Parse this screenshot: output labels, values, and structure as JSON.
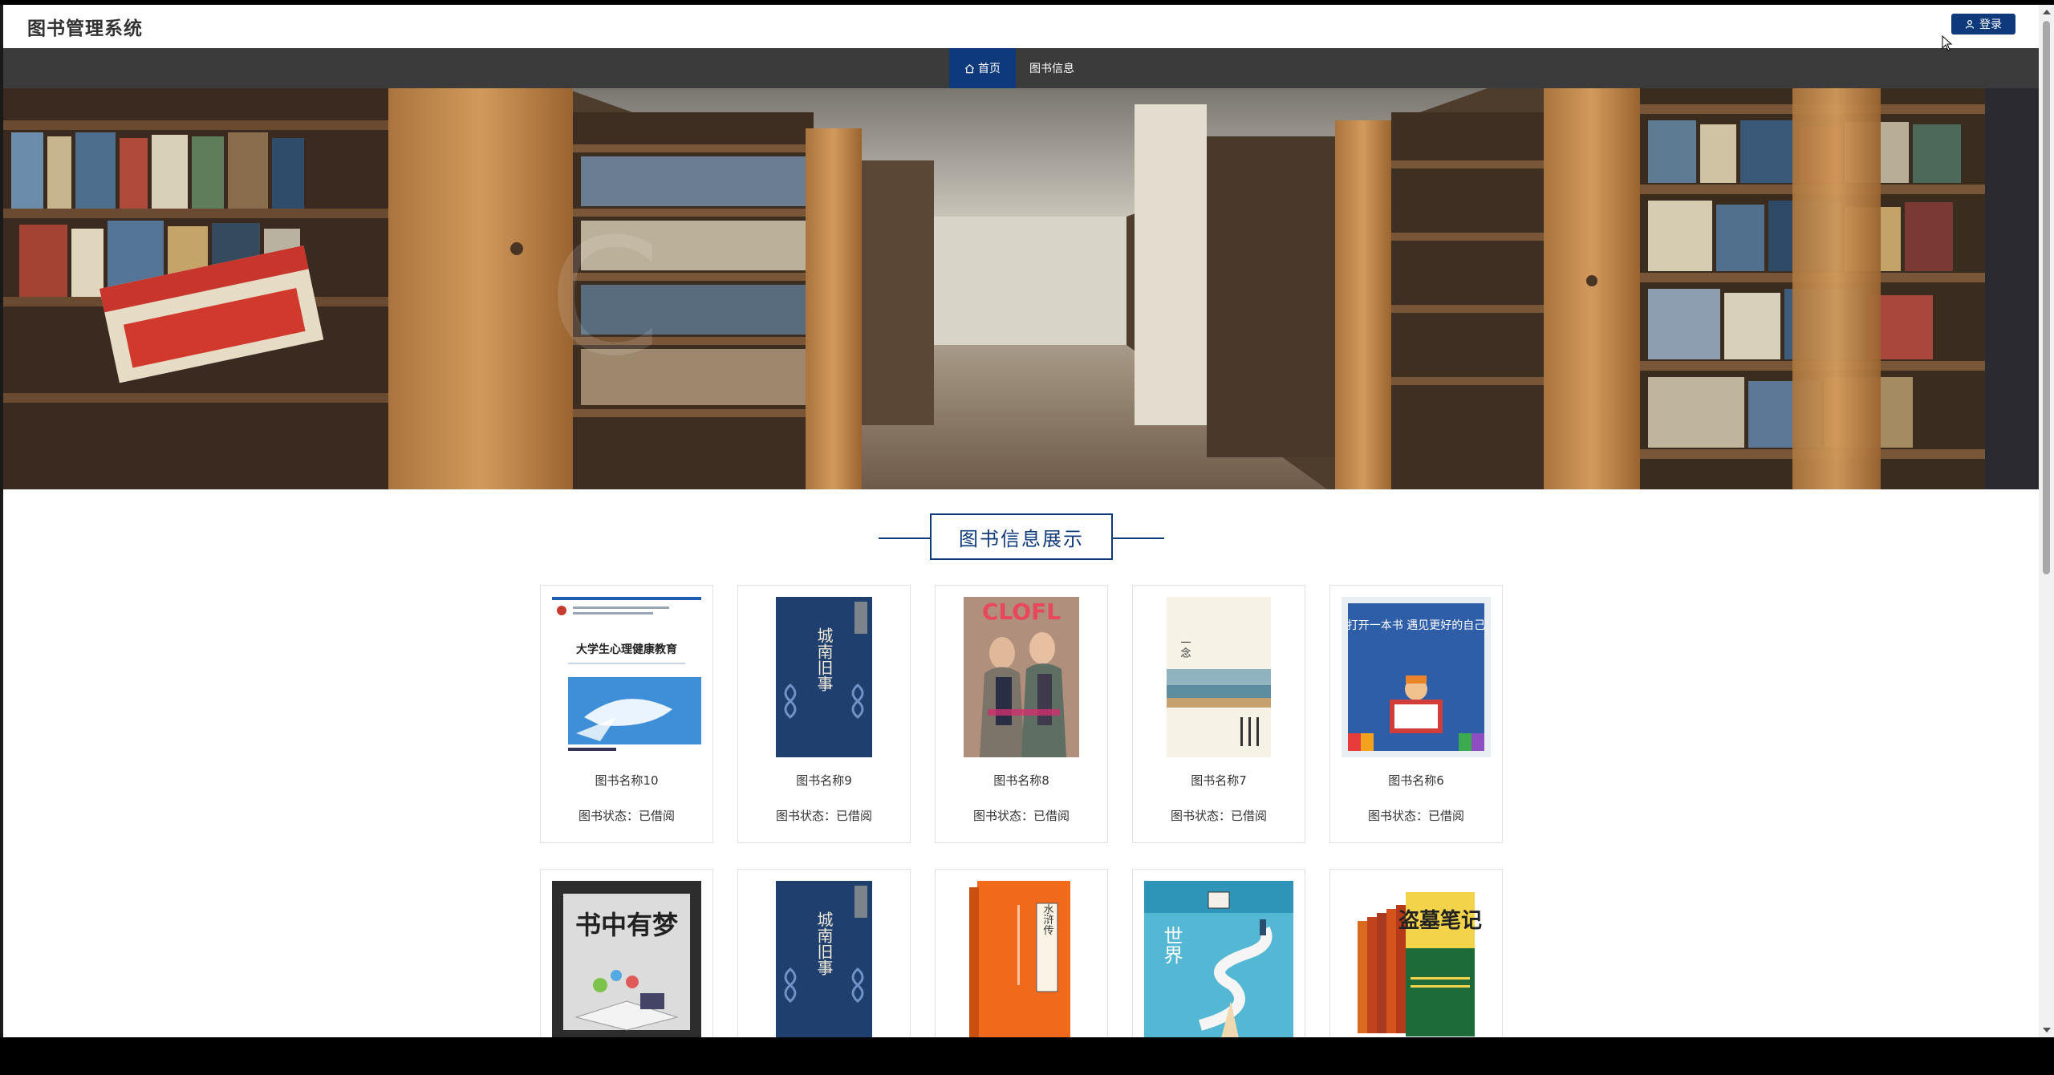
{
  "header": {
    "site_title": "图书管理系统",
    "login_label": "登录"
  },
  "nav": {
    "items": [
      {
        "label": "首页",
        "active": true
      },
      {
        "label": "图书信息",
        "active": false
      }
    ]
  },
  "section": {
    "title": "图书信息展示"
  },
  "books": [
    {
      "name": "图书名称10",
      "status": "图书状态：已借阅",
      "cover_text": "大学生心理健康教育"
    },
    {
      "name": "图书名称9",
      "status": "图书状态：已借阅",
      "cover_text": "城南旧事"
    },
    {
      "name": "图书名称8",
      "status": "图书状态：已借阅",
      "cover_text": "CLOFL"
    },
    {
      "name": "图书名称7",
      "status": "图书状态：已借阅",
      "cover_text": "一念"
    },
    {
      "name": "图书名称6",
      "status": "图书状态：已借阅",
      "cover_text": "打开一本书 遇见更好的自己"
    },
    {
      "name": "",
      "status": "",
      "cover_text": "书中有梦"
    },
    {
      "name": "",
      "status": "",
      "cover_text": "城南旧事"
    },
    {
      "name": "",
      "status": "",
      "cover_text": "水浒传"
    },
    {
      "name": "",
      "status": "",
      "cover_text": "世界"
    },
    {
      "name": "",
      "status": "",
      "cover_text": "盗墓笔记"
    }
  ],
  "colors": {
    "brand": "#0e3a7c",
    "navbar": "#3b3b3b"
  }
}
